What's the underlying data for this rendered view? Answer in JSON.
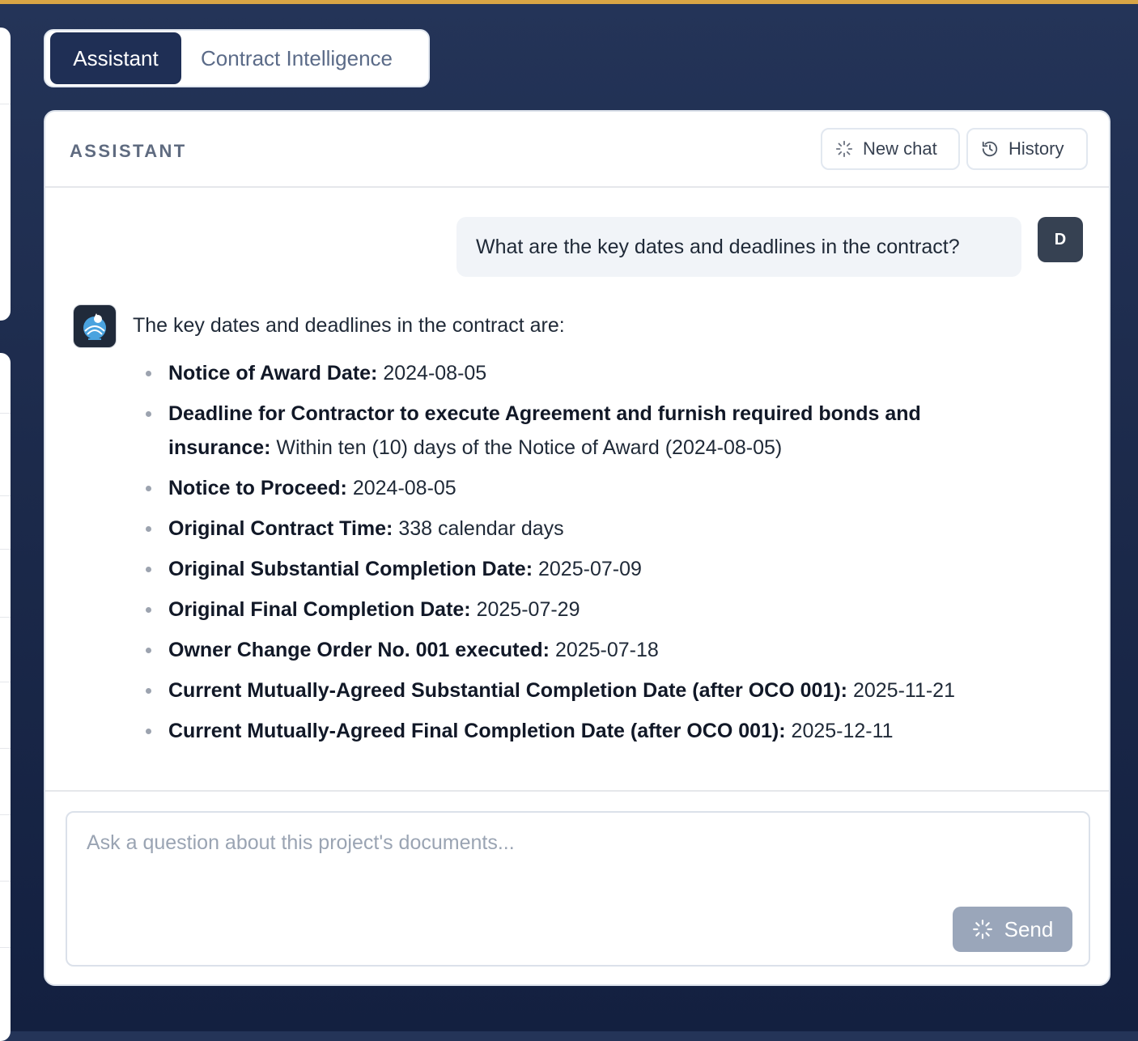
{
  "tabs": [
    {
      "label": "Assistant",
      "active": true
    },
    {
      "label": "Contract Intelligence",
      "active": false
    }
  ],
  "panel": {
    "title": "ASSISTANT",
    "new_chat_label": "New chat",
    "history_label": "History"
  },
  "conversation": {
    "user_initial": "D",
    "user_message": "What are the key dates and deadlines in the contract?",
    "assistant_intro": "The key dates and deadlines in the contract are:",
    "items": [
      {
        "label": "Notice of Award Date:",
        "value": "2024-08-05"
      },
      {
        "label": "Deadline for Contractor to execute Agreement and furnish required bonds and insurance:",
        "value": "Within ten (10) days of the Notice of Award (2024-08-05)"
      },
      {
        "label": "Notice to Proceed:",
        "value": "2024-08-05"
      },
      {
        "label": "Original Contract Time:",
        "value": "338 calendar days"
      },
      {
        "label": "Original Substantial Completion Date:",
        "value": "2025-07-09"
      },
      {
        "label": "Original Final Completion Date:",
        "value": "2025-07-29"
      },
      {
        "label": "Owner Change Order No. 001 executed:",
        "value": "2025-07-18"
      },
      {
        "label": "Current Mutually-Agreed Substantial Completion Date (after OCO 001):",
        "value": "2025-11-21"
      },
      {
        "label": "Current Mutually-Agreed Final Completion Date (after OCO 001):",
        "value": "2025-12-11"
      }
    ]
  },
  "composer": {
    "placeholder": "Ask a question about this project's documents...",
    "value": "",
    "send_label": "Send"
  },
  "colors": {
    "accent_bar": "#d8a545",
    "active_tab": "#1f2f55",
    "send_button_disabled": "#9aa6ba",
    "user_avatar": "#364152"
  }
}
